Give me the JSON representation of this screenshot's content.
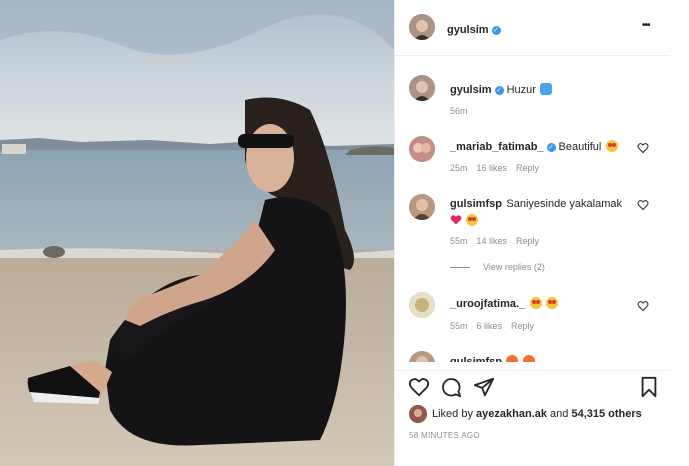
{
  "post": {
    "author": "gyulsim",
    "caption": "Huzur",
    "caption_time": "56m",
    "header_more": "•••"
  },
  "comments": [
    {
      "user": "_mariab_fatimab_",
      "verified": true,
      "text": "Beautiful",
      "emoji": "star-struck",
      "time": "25m",
      "likes": "16 likes",
      "reply": "Reply"
    },
    {
      "user": "gulsimfsp",
      "verified": false,
      "text": "Saniyesinde yakalamak",
      "emoji": "red-heart star-struck",
      "time": "55m",
      "likes": "14 likes",
      "reply": "Reply",
      "view_replies": "View replies (2)"
    },
    {
      "user": "_uroojfatima._",
      "verified": false,
      "text": "",
      "emoji": "star-struck star-struck",
      "time": "55m",
      "likes": "6 likes",
      "reply": "Reply"
    },
    {
      "user": "gulsimfsp",
      "verified": false,
      "text": "",
      "emoji": "fire fire"
    }
  ],
  "likes": {
    "prefix": "Liked by",
    "user": "ayezakhan.ak",
    "middle": "and",
    "count": "54,315 others"
  },
  "timestamp": "58 MINUTES AGO",
  "colors": {
    "accent": "#3897f0",
    "meta": "#8e8e8e",
    "heart": "#e0245e"
  }
}
